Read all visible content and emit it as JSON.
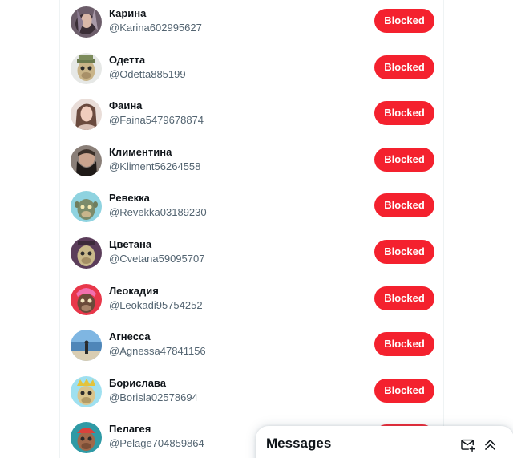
{
  "blocked_list": {
    "button_label": "Blocked",
    "button_color": "#f4212e",
    "users": [
      {
        "name": "Карина",
        "handle": "@Karina602995627",
        "avatar": "avatar-photo-dark-hair"
      },
      {
        "name": "Одетта",
        "handle": "@Odetta885199",
        "avatar": "avatar-ape-cartoon"
      },
      {
        "name": "Фаина",
        "handle": "@Faina5479678874",
        "avatar": "avatar-photo-woman"
      },
      {
        "name": "Климентина",
        "handle": "@Kliment56264558",
        "avatar": "avatar-photo-beard"
      },
      {
        "name": "Ревекка",
        "handle": "@Revekka03189230",
        "avatar": "avatar-ape-cartoon"
      },
      {
        "name": "Цветана",
        "handle": "@Cvetana59095707",
        "avatar": "avatar-ape-cartoon"
      },
      {
        "name": "Леокадия",
        "handle": "@Leokadi95754252",
        "avatar": "avatar-ape-cartoon"
      },
      {
        "name": "Агнесса",
        "handle": "@Agnessa47841156",
        "avatar": "avatar-photo-seaside"
      },
      {
        "name": "Борислава",
        "handle": "@Borisla02578694",
        "avatar": "avatar-ape-cartoon"
      },
      {
        "name": "Пелагея",
        "handle": "@Pelage704859864",
        "avatar": "avatar-ape-cartoon"
      }
    ]
  },
  "messages_drawer": {
    "title": "Messages",
    "new_message_icon": "mail-plus-icon",
    "expand_icon": "double-chevron-up-icon"
  }
}
